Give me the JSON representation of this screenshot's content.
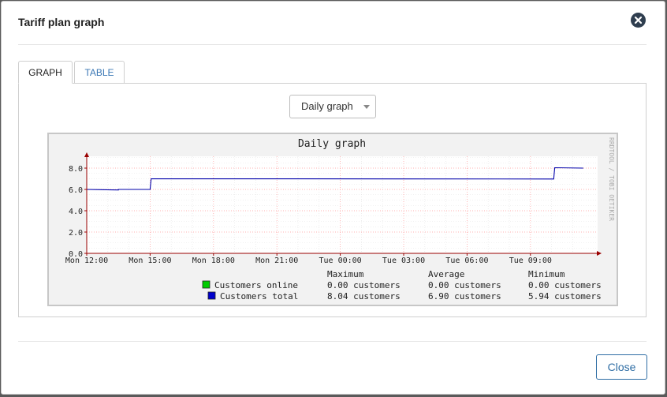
{
  "modal": {
    "title": "Tariff plan graph",
    "close_button_label": "Close"
  },
  "tabs": [
    {
      "label": "GRAPH",
      "active": true
    },
    {
      "label": "TABLE",
      "active": false
    }
  ],
  "period_select": {
    "selected": "Daily graph"
  },
  "colors": {
    "accent": "#2e6da4",
    "tab_link": "#3c78b5",
    "series_online": "#00cc00",
    "series_total": "#0000ff",
    "grid_major": "#ff9999",
    "axis": "#990000"
  },
  "chart_data": {
    "type": "line",
    "title": "Daily graph",
    "watermark": "RRDTOOL / TOBI OETIKER",
    "x_ticks": [
      "Mon 12:00",
      "Mon 15:00",
      "Mon 18:00",
      "Mon 21:00",
      "Tue 00:00",
      "Tue 03:00",
      "Tue 06:00",
      "Tue 09:00"
    ],
    "x_range_hours": [
      0,
      23.5
    ],
    "y_ticks": [
      "0.0",
      "2.0",
      "4.0",
      "6.0",
      "8.0"
    ],
    "ylim": [
      0,
      9
    ],
    "series": [
      {
        "name": "Customers online",
        "color": "#00cc00",
        "x_hours": [
          0,
          23.5
        ],
        "values": [
          0,
          0
        ],
        "maximum": "0.00 customers",
        "average": "0.00 customers",
        "minimum": "0.00 customers"
      },
      {
        "name": "Customers total",
        "color": "#0000ff",
        "x_hours": [
          0,
          1.5,
          1.5,
          3.0,
          3.05,
          22.1,
          22.15,
          23.5
        ],
        "values": [
          6.0,
          5.95,
          6.0,
          6.0,
          7.0,
          6.98,
          8.04,
          8.0
        ],
        "maximum": "8.04 customers",
        "average": "6.90 customers",
        "minimum": "5.94 customers"
      }
    ],
    "legend_headers": [
      "Maximum",
      "Average",
      "Minimum"
    ]
  }
}
